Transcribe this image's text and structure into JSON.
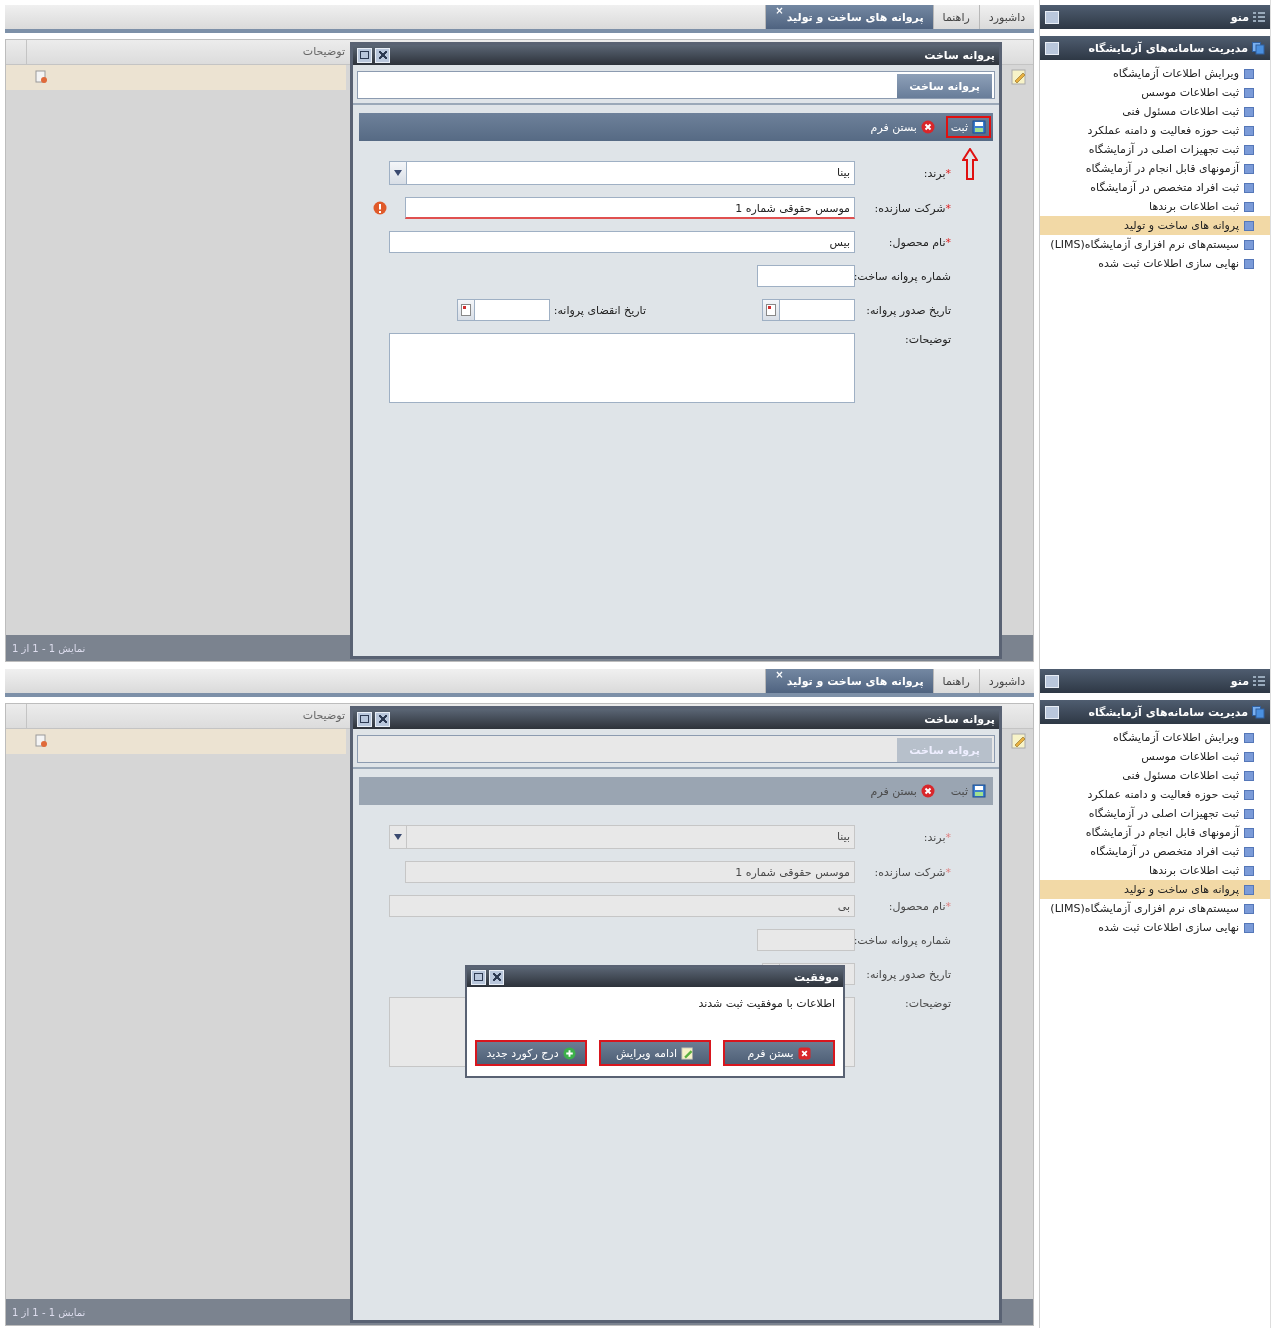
{
  "screens": [
    {
      "tabs": [
        {
          "label": "داشبورد",
          "selected": false
        },
        {
          "label": "راهنما",
          "selected": false
        },
        {
          "label": "پروانه های ساخت و تولید",
          "selected": true,
          "close_mark": "×"
        }
      ],
      "grid": {
        "column": "توضیحات",
        "row_selected": true,
        "footer": "نمایش 1 - 1 از 1"
      },
      "window": {
        "title": "پروانه ساخت",
        "tab": "پروانه ساخت",
        "disabled": false,
        "toolbar": {
          "save": "ثبت",
          "close": "بستن فرم",
          "save_highlighted": true
        },
        "fields": [
          {
            "kind": "select",
            "mark": "*",
            "label": "برند:",
            "value": "بینا"
          },
          {
            "kind": "text",
            "mark": "*",
            "label": "شرکت سازنده:",
            "value": "موسس حقوقی شماره 1",
            "error": true
          },
          {
            "kind": "text",
            "mark": "*",
            "label": "نام محصول:",
            "value": "بیس",
            "error": false
          },
          {
            "kind": "short",
            "label": "شماره پروانه ساخت:"
          },
          {
            "kind": "dates",
            "label": "تاریخ صدور پروانه:",
            "label2": "تاریخ انقضای پروانه:"
          },
          {
            "kind": "textarea",
            "label": "توضیحات:"
          }
        ]
      },
      "menu": {
        "title": "منو",
        "section": "مدیریت سامانه‌های آزمایشگاه",
        "items": [
          {
            "label": "ویرایش اطلاعات آزمایشگاه",
            "selected": false
          },
          {
            "label": "ثبت اطلاعات موسس",
            "selected": false
          },
          {
            "label": "ثبت اطلاعات مسئول فنی",
            "selected": false
          },
          {
            "label": "ثبت حوزه فعالیت و دامنه عملکرد",
            "selected": false
          },
          {
            "label": "ثبت تجهیزات اصلی در آزمایشگاه",
            "selected": false
          },
          {
            "label": "آزمونهای قابل انجام در آزمایشگاه",
            "selected": false
          },
          {
            "label": "ثبت افراد متخصص در آزمایشگاه",
            "selected": false
          },
          {
            "label": "ثبت اطلاعات برندها",
            "selected": false
          },
          {
            "label": "پروانه های ساخت و تولید",
            "selected": true
          },
          {
            "label": "سیستم‌های نرم افزاری آزمایشگاه(LIMS)",
            "selected": false
          },
          {
            "label": "نهایی سازی اطلاعات ثبت شده",
            "selected": false
          }
        ]
      }
    },
    {
      "tabs": [
        {
          "label": "داشبورد",
          "selected": false
        },
        {
          "label": "راهنما",
          "selected": false
        },
        {
          "label": "پروانه های ساخت و تولید",
          "selected": true,
          "close_mark": "×"
        }
      ],
      "grid": {
        "column": "توضیحات",
        "row_selected": true,
        "footer": "نمایش 1 - 1 از 1"
      },
      "window": {
        "title": "پروانه ساخت",
        "tab": "پروانه ساخت",
        "disabled": true,
        "toolbar": {
          "save": "ثبت",
          "close": "بستن فرم",
          "save_highlighted": false
        },
        "fields": [
          {
            "kind": "select",
            "mark": "*",
            "label": "برند:",
            "value": "بینا"
          },
          {
            "kind": "text",
            "mark": "*",
            "label": "شرکت سازنده:",
            "value": "موسس حقوقی شماره 1",
            "error": false
          },
          {
            "kind": "text",
            "mark": "*",
            "label": "نام محصول:",
            "value": "بی",
            "error": false
          },
          {
            "kind": "short",
            "label": "شماره پروانه ساخت:"
          },
          {
            "kind": "dates",
            "label": "تاریخ صدور پروانه:"
          },
          {
            "kind": "textarea",
            "label": "توضیحات:"
          }
        ],
        "dialog": {
          "title": "موفقیت",
          "message": "اطلاعات با موفقیت ثبت شدند",
          "buttons": [
            {
              "label": "بستن فرم",
              "kind": "close",
              "highlighted": true
            },
            {
              "label": "ادامه ویرایش",
              "kind": "edit",
              "highlighted": true
            },
            {
              "label": "درج رکورد جدید",
              "kind": "add",
              "highlighted": true
            }
          ]
        }
      },
      "menu": {
        "title": "منو",
        "section": "مدیریت سامانه‌های آزمایشگاه",
        "items": [
          {
            "label": "ویرایش اطلاعات آزمایشگاه",
            "selected": false
          },
          {
            "label": "ثبت اطلاعات موسس",
            "selected": false
          },
          {
            "label": "ثبت اطلاعات مسئول فنی",
            "selected": false
          },
          {
            "label": "ثبت حوزه فعالیت و دامنه عملکرد",
            "selected": false
          },
          {
            "label": "ثبت تجهیزات اصلی در آزمایشگاه",
            "selected": false
          },
          {
            "label": "آزمونهای قابل انجام در آزمایشگاه",
            "selected": false
          },
          {
            "label": "ثبت افراد متخصص در آزمایشگاه",
            "selected": false
          },
          {
            "label": "ثبت اطلاعات برندها",
            "selected": false
          },
          {
            "label": "پروانه های ساخت و تولید",
            "selected": true
          },
          {
            "label": "سیستم‌های نرم افزاری آزمایشگاه(LIMS)",
            "selected": false
          },
          {
            "label": "نهایی سازی اطلاعات ثبت شده",
            "selected": false
          }
        ]
      }
    }
  ]
}
